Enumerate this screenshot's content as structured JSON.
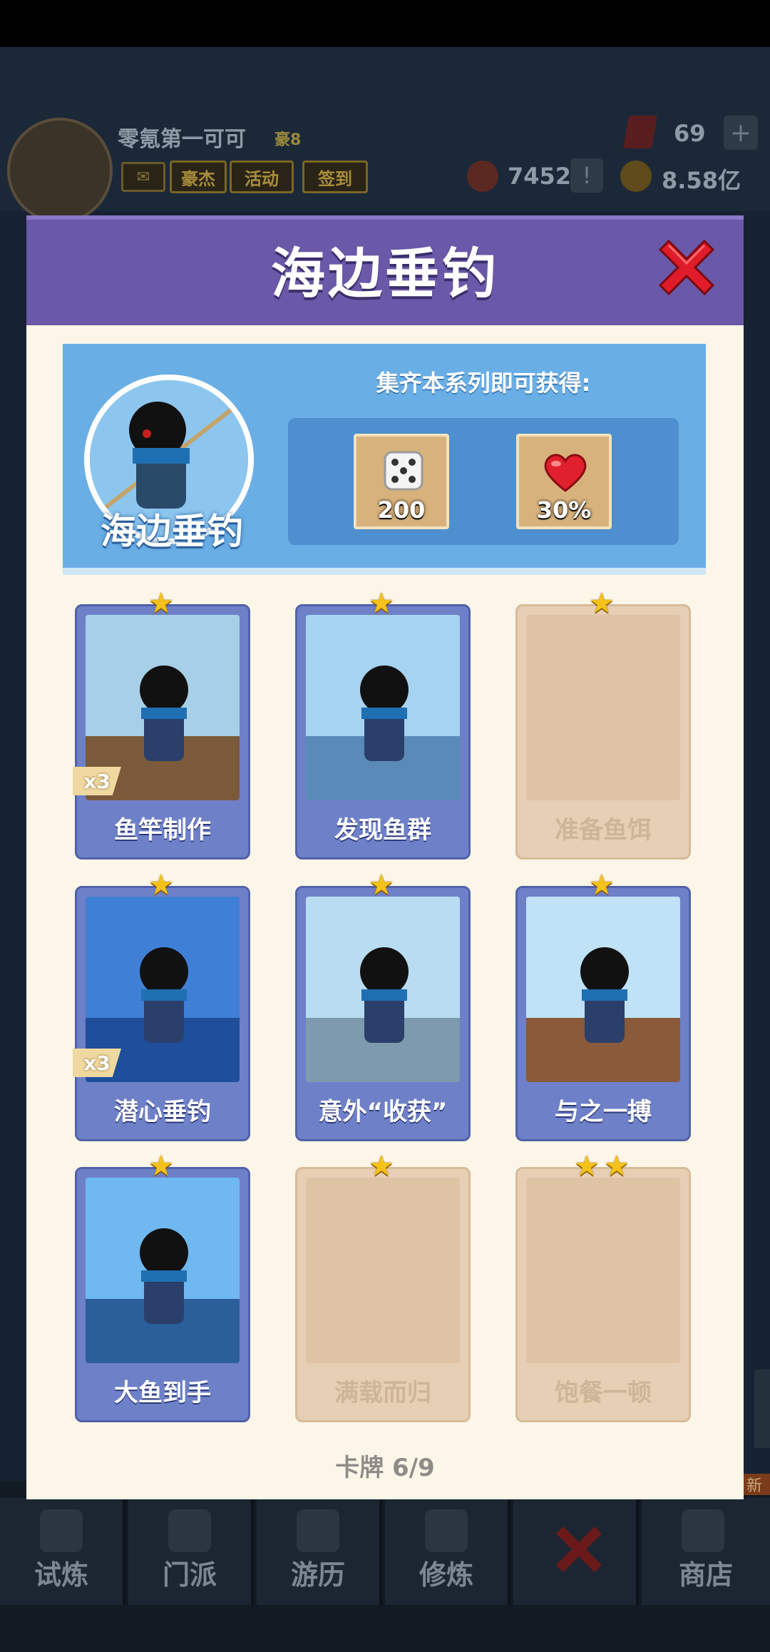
{
  "background": {
    "player": {
      "nickname": "零氪第一可可",
      "rank": "豪8"
    },
    "buttons": [
      {
        "label": "豪杰"
      },
      {
        "label": "活动"
      },
      {
        "label": "签到"
      }
    ],
    "currencies": {
      "gems": "69",
      "tokens": "7452",
      "coins": "8.58亿"
    },
    "plus_label": "+",
    "excl_label": "!",
    "new_badge": "新",
    "nav": [
      {
        "label": "试炼"
      },
      {
        "label": "门派"
      },
      {
        "label": "游历"
      },
      {
        "label": "修炼"
      },
      {
        "label": ""
      },
      {
        "label": "商店"
      }
    ]
  },
  "modal": {
    "title": "海边垂钓",
    "series_name": "海边垂钓",
    "reward_title": "集齐本系列即可获得:",
    "rewards": [
      {
        "icon": "dice-icon",
        "value": "200"
      },
      {
        "icon": "heart-icon",
        "value": "30%"
      }
    ],
    "cards": [
      {
        "name": "鱼竿制作",
        "stars": 1,
        "owned": true,
        "count": "x3"
      },
      {
        "name": "发现鱼群",
        "stars": 1,
        "owned": true,
        "count": ""
      },
      {
        "name": "准备鱼饵",
        "stars": 1,
        "owned": false,
        "count": ""
      },
      {
        "name": "潜心垂钓",
        "stars": 1,
        "owned": true,
        "count": "x3"
      },
      {
        "name": "意外“收获”",
        "stars": 1,
        "owned": true,
        "count": ""
      },
      {
        "name": "与之一搏",
        "stars": 1,
        "owned": true,
        "count": ""
      },
      {
        "name": "大鱼到手",
        "stars": 1,
        "owned": true,
        "count": ""
      },
      {
        "name": "满载而归",
        "stars": 1,
        "owned": false,
        "count": ""
      },
      {
        "name": "饱餐一顿",
        "stars": 2,
        "owned": false,
        "count": ""
      }
    ],
    "progress": "卡牌  6/9"
  },
  "colors": {
    "header": "#6a58a8",
    "banner": "#6aaee6",
    "card_owned": "#6e80c8",
    "card_locked": "#e6cfb4",
    "star": "#f4c21a"
  }
}
